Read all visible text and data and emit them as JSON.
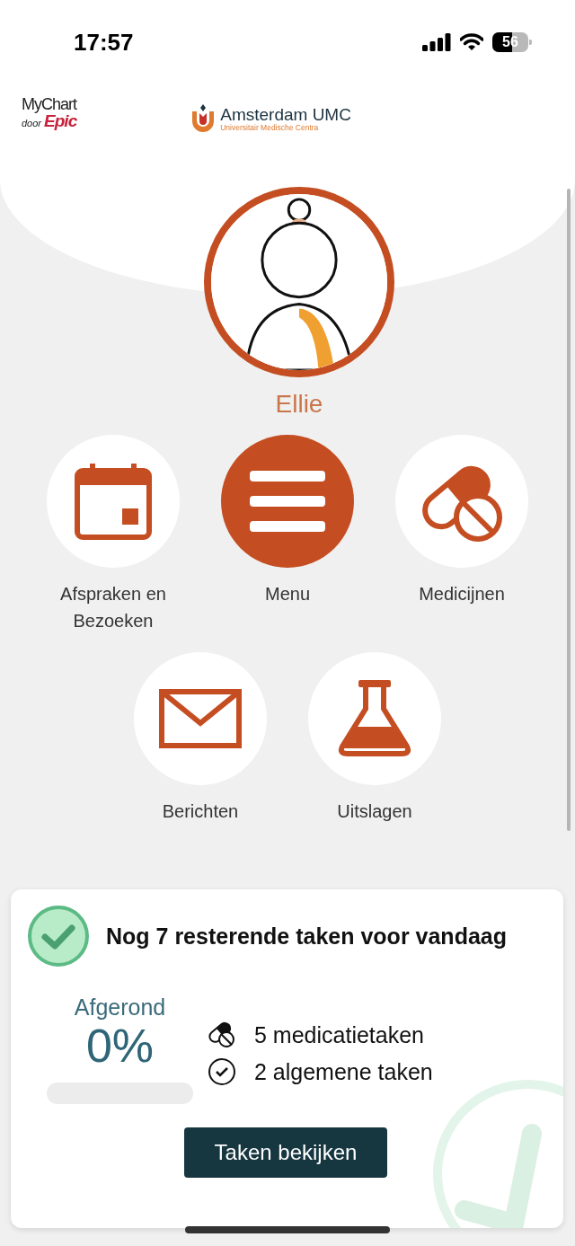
{
  "status_bar": {
    "time": "17:57",
    "battery": "56"
  },
  "header": {
    "mychart_logo": {
      "name": "MyChart",
      "by": "door",
      "brand": "Epic"
    },
    "hospital_logo": {
      "name": "Amsterdam UMC",
      "subtitle": "Universitair Medische Centra"
    }
  },
  "profile": {
    "name": "Ellie"
  },
  "shortcuts": [
    {
      "label": "Afspraken en Bezoeken",
      "kind": "calendar",
      "selected": false
    },
    {
      "label": "Menu",
      "kind": "menu",
      "selected": true
    },
    {
      "label": "Medicijnen",
      "kind": "pills",
      "selected": false
    },
    {
      "label": "Berichten",
      "kind": "mail",
      "selected": false
    },
    {
      "label": "Uitslagen",
      "kind": "flask",
      "selected": false
    }
  ],
  "tasks_card": {
    "title": "Nog 7 resterende taken voor vandaag",
    "progress_label": "Afgerond",
    "progress_value": "0%",
    "level": 0,
    "items": [
      {
        "kind": "medication",
        "text": "5 medicatietaken"
      },
      {
        "kind": "general",
        "text": "2 algemene taken"
      }
    ],
    "button": "Taken bekijken"
  }
}
